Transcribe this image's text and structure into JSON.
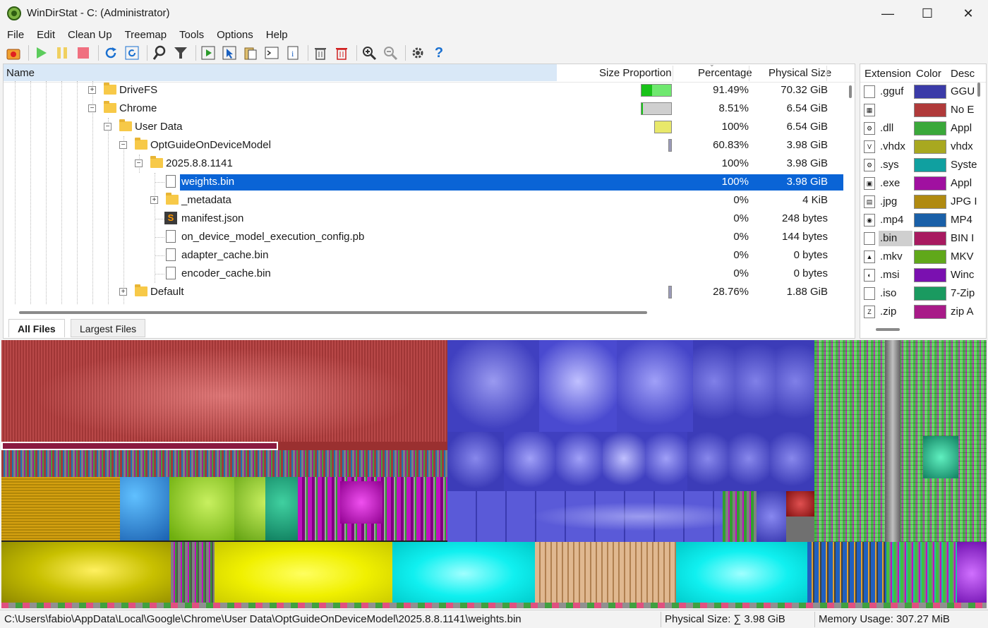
{
  "window": {
    "title": "WinDirStat - C:  (Administrator)",
    "minimize": "—",
    "maximize": "☐",
    "close": "✕"
  },
  "menu": [
    "File",
    "Edit",
    "Clean Up",
    "Treemap",
    "Tools",
    "Options",
    "Help"
  ],
  "tree": {
    "columns": {
      "name": "Name",
      "size_proportion": "Size Proportion",
      "percentage": "Percentage",
      "physical_size": "Physical Size"
    },
    "rows": [
      {
        "name": "DriveFS",
        "pct": "91.49%",
        "size": "70.32 GiB",
        "kind": "folder",
        "expander": "+",
        "proportion": 0.915,
        "bar_width": 44,
        "bar_color": "#6fe86f"
      },
      {
        "name": "Chrome",
        "pct": "8.51%",
        "size": "6.54 GiB",
        "kind": "folder",
        "expander": "−",
        "proportion": 0.085,
        "bar_width": 44,
        "bar_color": "#cfcfcf"
      },
      {
        "name": "User Data",
        "pct": "100%",
        "size": "6.54 GiB",
        "kind": "folder",
        "expander": "−",
        "proportion": 1.0,
        "bar_color": "#e8e86a"
      },
      {
        "name": "OptGuideOnDeviceModel",
        "pct": "60.83%",
        "size": "3.98 GiB",
        "kind": "folder",
        "expander": "−",
        "proportion": 0.608,
        "bar_color": "#9a9ab8"
      },
      {
        "name": "2025.8.8.1141",
        "pct": "100%",
        "size": "3.98 GiB",
        "kind": "folder",
        "expander": "−"
      },
      {
        "name": "weights.bin",
        "pct": "100%",
        "size": "3.98 GiB",
        "kind": "file",
        "selected": true
      },
      {
        "name": "_metadata",
        "pct": "0%",
        "size": "4 KiB",
        "kind": "folder",
        "expander": "+"
      },
      {
        "name": "manifest.json",
        "pct": "0%",
        "size": "248 bytes",
        "kind": "sublime"
      },
      {
        "name": "on_device_model_execution_config.pb",
        "pct": "0%",
        "size": "144 bytes",
        "kind": "file"
      },
      {
        "name": "adapter_cache.bin",
        "pct": "0%",
        "size": "0 bytes",
        "kind": "file"
      },
      {
        "name": "encoder_cache.bin",
        "pct": "0%",
        "size": "0 bytes",
        "kind": "file"
      },
      {
        "name": "Default",
        "pct": "28.76%",
        "size": "1.88 GiB",
        "kind": "folder",
        "expander": "+",
        "proportion": 0.288,
        "bar_color": "#9a9ab8"
      }
    ]
  },
  "tabs": {
    "all_files": "All Files",
    "largest_files": "Largest Files"
  },
  "extensions": {
    "columns": {
      "extension": "Extension",
      "color": "Color",
      "description": "Desc"
    },
    "rows": [
      {
        "ext": ".gguf",
        "color": "#3b3ba8",
        "desc": "GGU",
        "icon": ""
      },
      {
        "ext": "",
        "color": "#b03a3a",
        "desc": "No E",
        "icon": "▦"
      },
      {
        "ext": ".dll",
        "color": "#3aa83a",
        "desc": "Appl",
        "icon": "⚙"
      },
      {
        "ext": ".vhdx",
        "color": "#a8a820",
        "desc": "vhdx",
        "icon": "V"
      },
      {
        "ext": ".sys",
        "color": "#10a0a0",
        "desc": "Syste",
        "icon": "⚙"
      },
      {
        "ext": ".exe",
        "color": "#a010a0",
        "desc": "Appl",
        "icon": "▣"
      },
      {
        "ext": ".jpg",
        "color": "#b08a10",
        "desc": "JPG I",
        "icon": "▤"
      },
      {
        "ext": ".mp4",
        "color": "#1a60a8",
        "desc": "MP4",
        "icon": "◉"
      },
      {
        "ext": ".bin",
        "color": "#a81a60",
        "desc": "BIN I",
        "icon": "",
        "highlight": true
      },
      {
        "ext": ".mkv",
        "color": "#60a81a",
        "desc": "MKV",
        "icon": "▲"
      },
      {
        "ext": ".msi",
        "color": "#7a10b0",
        "desc": "Winc",
        "icon": "◐"
      },
      {
        "ext": ".iso",
        "color": "#1a9a60",
        "desc": "7-Zip",
        "icon": ""
      },
      {
        "ext": ".zip",
        "color": "#a81a88",
        "desc": "zip A",
        "icon": "Z"
      }
    ]
  },
  "status": {
    "path": "C:\\Users\\fabio\\AppData\\Local\\Google\\Chrome\\User Data\\OptGuideOnDeviceModel\\2025.8.8.1141\\weights.bin",
    "physical_size": "Physical Size: ∑ 3.98 GiB",
    "memory_usage": "Memory Usage: 307.27 MiB"
  },
  "colors": {
    "selection": "#0a64d6",
    "header_highlight": "#d9e8f7"
  }
}
